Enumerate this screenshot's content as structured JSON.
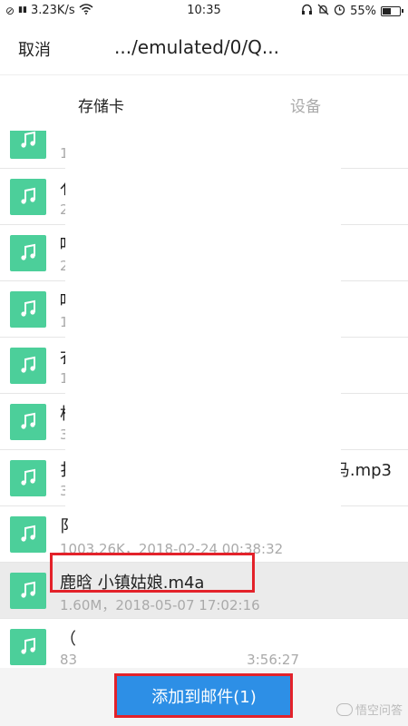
{
  "statusbar": {
    "network_speed": "3.23K/s",
    "time": "10:35",
    "battery": "55%",
    "battery_level": 0.55
  },
  "header": {
    "cancel_label": "取消",
    "path": ".../emulated/0/Q..."
  },
  "tabs": [
    {
      "label": "存储卡",
      "active": true
    },
    {
      "label": "设备",
      "active": false
    }
  ],
  "files": [
    {
      "name": "",
      "meta": "1",
      "tail_name": "",
      "tail_meta": ""
    },
    {
      "name": "亻",
      "meta": "2",
      "tail_name": "",
      "tail_meta": ""
    },
    {
      "name": "吓",
      "meta": "2",
      "tail_name": "",
      "tail_meta": ""
    },
    {
      "name": "吓",
      "meta": "1",
      "tail_name": "",
      "tail_meta": ""
    },
    {
      "name": "衣",
      "meta": "1",
      "tail_name": "",
      "tail_meta": ""
    },
    {
      "name": "杦",
      "meta": "3",
      "tail_name": "",
      "tail_meta": ""
    },
    {
      "name": "扌",
      "meta": "3",
      "tail_name": "马.mp3",
      "tail_meta": ""
    },
    {
      "name": "阝",
      "meta": "1003.26K，2018-02-24 00:38:32",
      "tail_name": "",
      "tail_meta": ""
    },
    {
      "name": "鹿晗 小镇姑娘.m4a",
      "meta": "1.60M，2018-05-07 17:02:16",
      "tail_name": "",
      "tail_meta": "",
      "selected": true
    },
    {
      "name": "（",
      "meta": "83",
      "tail_name": "",
      "tail_meta": "3:56:27"
    }
  ],
  "bottom": {
    "add_label": "添加到邮件(1)"
  },
  "watermark": {
    "text": "悟空问答"
  },
  "colors": {
    "file_icon": "#4ccf9a",
    "button": "#2d8fe6",
    "highlight_box": "#e3222a"
  }
}
